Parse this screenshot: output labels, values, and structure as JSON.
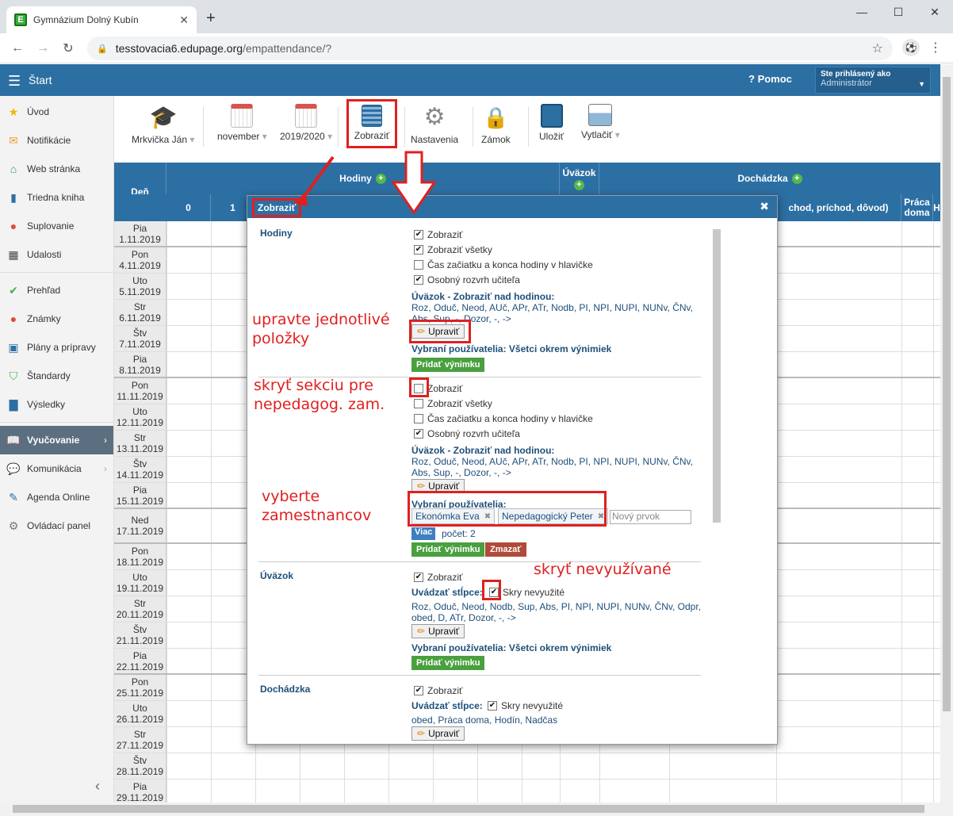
{
  "browser": {
    "tab_title": "Gymnázium Dolný Kubín",
    "favicon_letter": "E",
    "url_host": "tesstovacia6.edupage.org",
    "url_path": "/empattendance/?"
  },
  "app_header": {
    "start": "Štart",
    "help": "Pomoc",
    "user_line1": "Ste prihlásený ako",
    "user_line2": "Administrátor"
  },
  "sidebar": {
    "items": [
      {
        "label": "Úvod",
        "icon": "star-icon",
        "color": "#f5b400"
      },
      {
        "label": "Notifikácie",
        "icon": "envelope-icon",
        "color": "#f0a030"
      },
      {
        "label": "Web stránka",
        "icon": "home-icon",
        "color": "#2f9a5a"
      },
      {
        "label": "Triedna kniha",
        "icon": "book-icon",
        "color": "#2c6fa3"
      },
      {
        "label": "Suplovanie",
        "icon": "person-icon",
        "color": "#e04a3a"
      },
      {
        "label": "Udalosti",
        "icon": "calendar-icon",
        "color": "#444"
      },
      {
        "label": "Prehľad",
        "icon": "check-circle-icon",
        "color": "#3cb34a"
      },
      {
        "label": "Známky",
        "icon": "grade-icon",
        "color": "#e04a3a"
      },
      {
        "label": "Plány a prípravy",
        "icon": "briefcase-icon",
        "color": "#2c6fa3"
      },
      {
        "label": "Štandardy",
        "icon": "shield-icon",
        "color": "#3cb34a"
      },
      {
        "label": "Výsledky",
        "icon": "bar-chart-icon",
        "color": "#2c6fa3"
      },
      {
        "label": "Vyučovanie",
        "icon": "open-book-icon",
        "color": "#fff"
      },
      {
        "label": "Komunikácia",
        "icon": "chat-icon",
        "color": "#e04a3a"
      },
      {
        "label": "Agenda Online",
        "icon": "pen-icon",
        "color": "#2c6fa3"
      },
      {
        "label": "Ovládací panel",
        "icon": "gear-icon",
        "color": "#777"
      }
    ]
  },
  "toolbar": {
    "teacher": "Mrkvička Ján",
    "month": "november",
    "year": "2019/2020",
    "show": "Zobraziť",
    "settings": "Nastavenia",
    "lock": "Zámok",
    "save": "Uložiť",
    "print": "Vytlačiť"
  },
  "table": {
    "col_day": "Deň",
    "col_hours": "Hodiny",
    "col_load": "Úväzok",
    "col_attendance": "Dochádzka",
    "hour_0": "0",
    "hour_1": "1",
    "attendance_sub": "chod, príchod, dôvod)",
    "work_home_1": "Práca",
    "work_home_2": "doma",
    "h_letter": "H",
    "days": [
      {
        "d": "Pia",
        "date": "1.11.2019"
      },
      {
        "d": "Pon",
        "date": "4.11.2019"
      },
      {
        "d": "Uto",
        "date": "5.11.2019"
      },
      {
        "d": "Str",
        "date": "6.11.2019"
      },
      {
        "d": "Štv",
        "date": "7.11.2019"
      },
      {
        "d": "Pia",
        "date": "8.11.2019"
      },
      {
        "d": "Pon",
        "date": "11.11.2019"
      },
      {
        "d": "Uto",
        "date": "12.11.2019"
      },
      {
        "d": "Str",
        "date": "13.11.2019"
      },
      {
        "d": "Štv",
        "date": "14.11.2019"
      },
      {
        "d": "Pia",
        "date": "15.11.2019"
      },
      {
        "d": "Ned",
        "date": "17.11.2019"
      },
      {
        "d": "Pon",
        "date": "18.11.2019"
      },
      {
        "d": "Uto",
        "date": "19.11.2019"
      },
      {
        "d": "Str",
        "date": "20.11.2019"
      },
      {
        "d": "Štv",
        "date": "21.11.2019"
      },
      {
        "d": "Pia",
        "date": "22.11.2019"
      },
      {
        "d": "Pon",
        "date": "25.11.2019"
      },
      {
        "d": "Uto",
        "date": "26.11.2019"
      },
      {
        "d": "Str",
        "date": "27.11.2019"
      },
      {
        "d": "Štv",
        "date": "28.11.2019"
      },
      {
        "d": "Pia",
        "date": "29.11.2019"
      }
    ]
  },
  "dialog": {
    "title": "Zobraziť",
    "sec1": {
      "title": "Hodiny",
      "opt_show": "Zobraziť",
      "opt_show_all": "Zobraziť všetky",
      "opt_time": "Čas začiatku a konca hodiny v hlavičke",
      "opt_personal": "Osobný rozvrh učiteľa",
      "load_label": "Úväzok - Zobraziť nad hodinou:",
      "load_line1": "Roz, Oduč, Neod, AUč, APr, ATr, Nodb, PI, NPI, NUPI, NUNv, ČNv,",
      "load_line2": "Abs, Sup, -, Dozor, -, ->",
      "edit": "Upraviť",
      "users": "Vybraní používatelia: Všetci okrem výnimiek",
      "add_exc": "Pridať výnimku"
    },
    "sec2": {
      "opt_show": "Zobraziť",
      "opt_show_all": "Zobraziť všetky",
      "opt_time": "Čas začiatku a konca hodiny v hlavičke",
      "opt_personal": "Osobný rozvrh učiteľa",
      "load_label": "Úväzok - Zobraziť nad hodinou:",
      "load_line1": "Roz, Oduč, Neod, AUč, APr, ATr, Nodb, PI, NPI, NUPI, NUNv, ČNv,",
      "load_line2": "Abs, Sup, -, Dozor, -, ->",
      "edit": "Upraviť",
      "users_label": "Vybraní používatelia:",
      "tag1": "Ekonómka Eva",
      "tag2": "Nepedagogický Peter",
      "new_item": "Nový prvok",
      "more": "Viac",
      "count": "počet: 2",
      "add_exc": "Pridať výnimku",
      "delete": "Zmazať"
    },
    "sec3": {
      "title": "Úväzok",
      "opt_show": "Zobraziť",
      "cols_label": "Uvádzať stĺpce:",
      "hide_unused": "Skry nevyužité",
      "cols_line1": "Roz, Oduč, Neod, Nodb, Sup, Abs, PI, NPI, NUPI, NUNv, ČNv, Odpr,",
      "cols_line2": "obed, D, ATr, Dozor, -, ->",
      "edit": "Upraviť",
      "users": "Vybraní používatelia: Všetci okrem výnimiek",
      "add_exc": "Pridať výnimku"
    },
    "sec4": {
      "title": "Dochádzka",
      "opt_show": "Zobraziť",
      "cols_label": "Uvádzať stĺpce:",
      "hide_unused": "Skry nevyužité",
      "cols_line1": "obed, Práca doma, Hodín, Nadčas",
      "edit": "Upraviť"
    }
  },
  "annotations": {
    "a1_l1": "upravte jednotlivé",
    "a1_l2": "položky",
    "a2_l1": "skryť sekciu pre",
    "a2_l2": "nepedagog. zam.",
    "a3_l1": "vyberte",
    "a3_l2": "zamestnancov",
    "a4": "skryť nevyužívané"
  },
  "colors": {
    "header_blue": "#2c6fa3",
    "annotation_red": "#e02020",
    "button_green": "#4aa03f"
  }
}
